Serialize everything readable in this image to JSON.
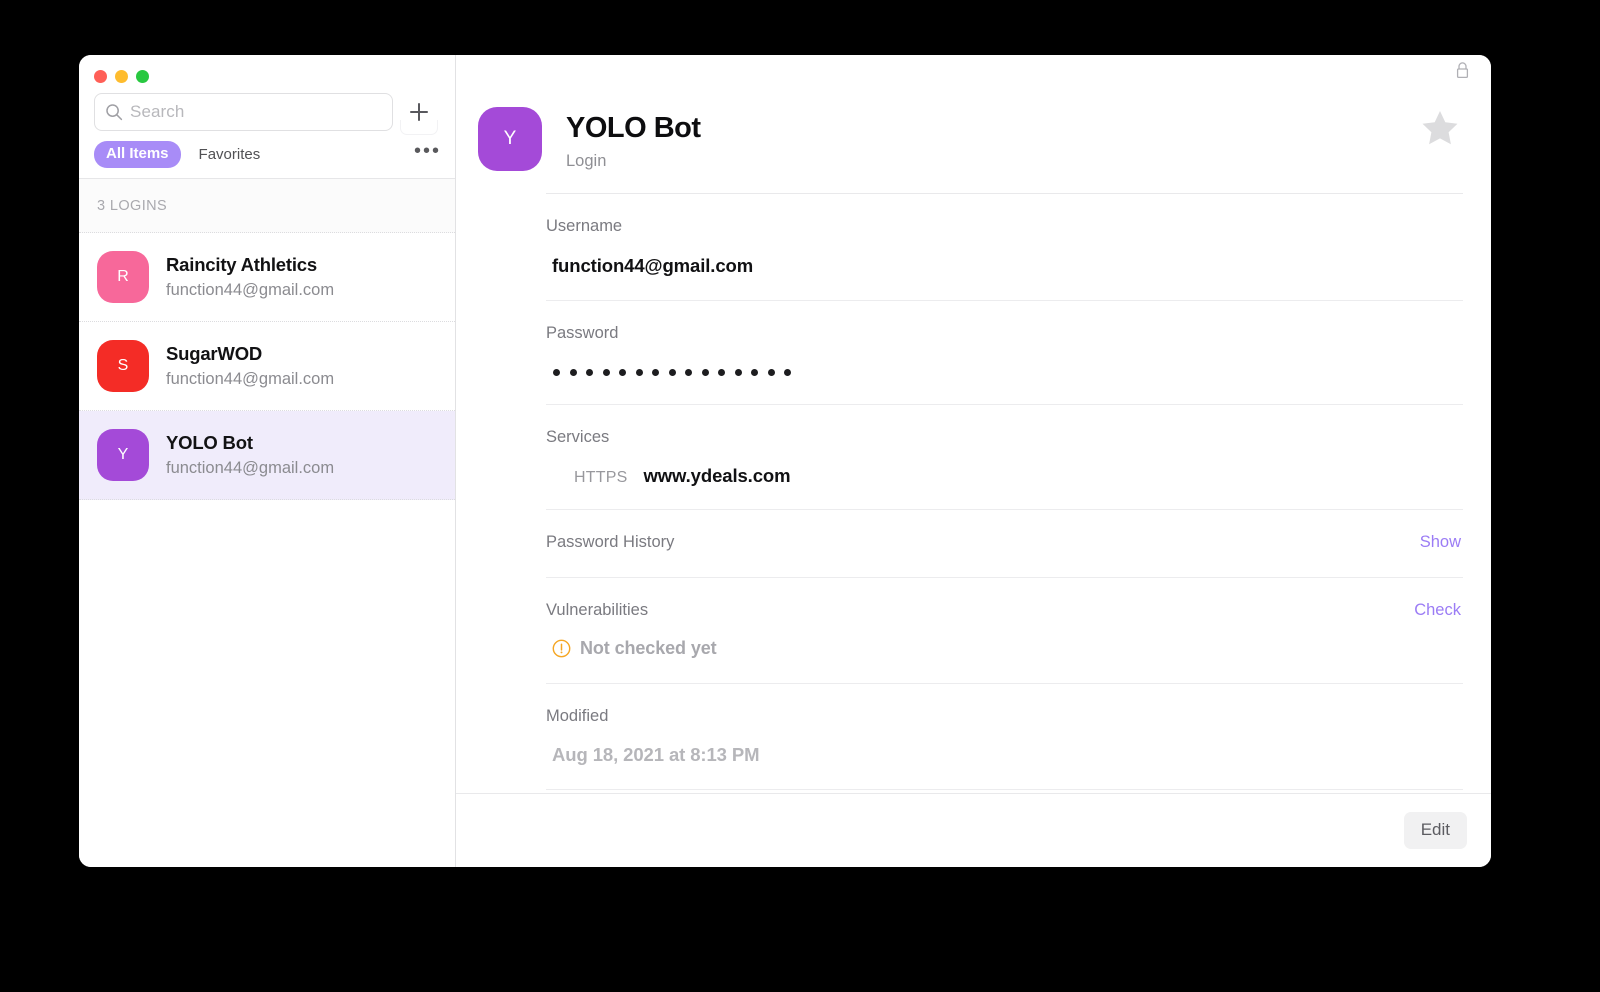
{
  "window": {
    "traffic_lights": [
      "close",
      "minimize",
      "zoom"
    ],
    "colors": {
      "accent_purple": "#a88cf7",
      "link_purple": "#9b7cf5",
      "selected_row": "#f0ecfb",
      "warning_orange": "#f5a623",
      "tl_red": "#ff5f57",
      "tl_yellow": "#febc2e",
      "tl_green": "#28c840"
    }
  },
  "sidebar": {
    "search": {
      "placeholder": "Search",
      "value": "",
      "icon": "search-icon"
    },
    "add_button_icon": "plus-icon",
    "tabs": [
      {
        "label": "All Items",
        "selected": true
      },
      {
        "label": "Favorites",
        "selected": false
      }
    ],
    "more_label": "•••",
    "section_header": "3 LOGINS",
    "items": [
      {
        "initial": "R",
        "title": "Raincity Athletics",
        "subtitle": "function44@gmail.com",
        "avatar_color": "#f7689a",
        "selected": false
      },
      {
        "initial": "S",
        "title": "SugarWOD",
        "subtitle": "function44@gmail.com",
        "avatar_color": "#f42c26",
        "selected": false
      },
      {
        "initial": "Y",
        "title": "YOLO Bot",
        "subtitle": "function44@gmail.com",
        "avatar_color": "#a44ad8",
        "selected": true
      }
    ]
  },
  "detail": {
    "lock_icon": "lock-icon",
    "favorite_icon": "star-icon",
    "avatar_initial": "Y",
    "avatar_color": "#a44ad8",
    "title": "YOLO Bot",
    "category": "Login",
    "fields": {
      "username": {
        "label": "Username",
        "value": "function44@gmail.com"
      },
      "password": {
        "label": "Password",
        "masked_value": "•••••••••••••••",
        "dot_count": 15
      },
      "services": {
        "label": "Services",
        "scheme": "HTTPS",
        "url": "www.ydeals.com"
      },
      "password_history": {
        "label": "Password History",
        "action": "Show"
      },
      "vulnerabilities": {
        "label": "Vulnerabilities",
        "action": "Check",
        "status": "Not checked yet",
        "status_icon": "warning-circle-icon"
      },
      "modified": {
        "label": "Modified",
        "value": "Aug 18, 2021 at 8:13 PM"
      }
    },
    "footer": {
      "edit_label": "Edit"
    }
  }
}
